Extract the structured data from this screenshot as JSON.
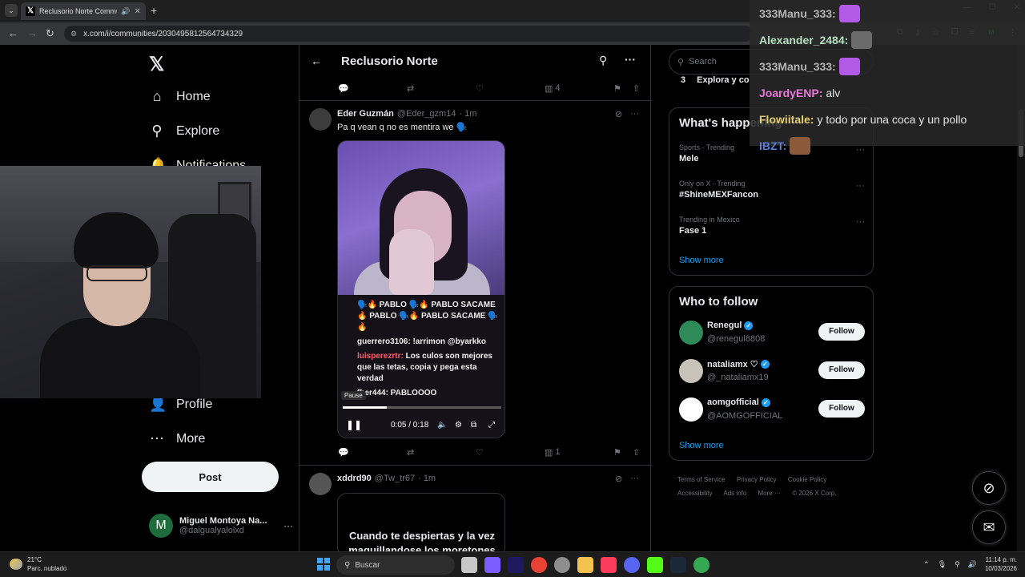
{
  "browser": {
    "tab_title": "Reclusorio Norte Commun",
    "url": "x.com/i/communities/2030495812564734329",
    "profile_initial": "M"
  },
  "nav": {
    "items": [
      {
        "label": "Home",
        "icon": "home-icon"
      },
      {
        "label": "Explore",
        "icon": "search-icon"
      },
      {
        "label": "Notifications",
        "icon": "bell-icon"
      },
      {
        "label": "Profile",
        "icon": "person-icon"
      },
      {
        "label": "More",
        "icon": "more-circle-icon"
      }
    ],
    "post_label": "Post",
    "account": {
      "initial": "M",
      "name": "Miguel Montoya Na...",
      "handle": "@daigualyalolxd"
    }
  },
  "community": {
    "title": "Reclusorio Norte"
  },
  "prev_tweet": {
    "views": "4"
  },
  "tweet1": {
    "name": "Eder Guzmán",
    "handle": "@Eder_gzm14",
    "time": "· 1m",
    "text": "Pa q vean q no es mentira we 🗣️",
    "video": {
      "chat_rows": [
        "🗣️🔥 PABLO 🗣️🔥 PABLO SACAME 🔥 PABLO 🗣️🔥 PABLO SACAME 🗣️🔥",
        "guerrero3106: !arrimon @byarkko"
      ],
      "chat_red_user": "luisperezrtr:",
      "chat_red_msg": "Los culos son mejores que las tetas, copia y pega esta verdad",
      "chat_last": "fher444: PABLOOOO",
      "pause_tooltip": "Pause",
      "time_display": "0:05 / 0:18",
      "progress": 0.28
    },
    "views": "1"
  },
  "tweet2": {
    "name": "xddrd90",
    "handle": "@Tw_tr67",
    "time": "· 1m",
    "caption": "Cuando te despiertas y la vez maquillandose los moretones"
  },
  "right": {
    "search_placeholder": "Search",
    "explore_num": "3",
    "explore_text": "Explora y co",
    "happening_title": "What's happening",
    "trends": [
      {
        "category": "Sports · Trending",
        "title": "Mele"
      },
      {
        "category": "Only on X · Trending",
        "title": "#ShineMEXFancon"
      },
      {
        "category": "Trending in Mexico",
        "title": "Fase 1"
      }
    ],
    "show_more": "Show more",
    "who_title": "Who to follow",
    "follow": [
      {
        "name": "Renegul",
        "handle": "@renegul8808",
        "btn": "Follow",
        "color": "#2e8b57"
      },
      {
        "name": "nataliamx ♡",
        "handle": "@_nataliamx19",
        "btn": "Follow",
        "color": "#c9c2b8"
      },
      {
        "name": "aomgofficial",
        "handle": "@AOMGOFFICIAL",
        "btn": "Follow",
        "color": "#ffffff"
      }
    ],
    "footer": [
      "Terms of Service",
      "Privacy Policy",
      "Cookie Policy",
      "Accessibility",
      "Ads info",
      "More ···",
      "© 2026 X Corp."
    ]
  },
  "chat_overlay": {
    "lines": [
      {
        "user": "333Manu_333:",
        "color": "#b5b5b5",
        "msg": ""
      },
      {
        "user": "Alexander_2484:",
        "color": "#b7dfc0",
        "msg": ""
      },
      {
        "user": "333Manu_333:",
        "color": "#b5b5b5",
        "msg": ""
      },
      {
        "user": "JoardyENP:",
        "color": "#e87ad8",
        "msg": "alv"
      },
      {
        "user": "Flowiitale:",
        "color": "#e8d06a",
        "msg": "y todo por una coca y un pollo"
      },
      {
        "user": "IBZT:",
        "color": "#5a7fd8",
        "msg": ""
      }
    ]
  },
  "taskbar": {
    "temp": "21°C",
    "weather": "Parc. nublado",
    "search_label": "Buscar",
    "time": "11:14 p. m.",
    "date": "10/03/2026"
  }
}
